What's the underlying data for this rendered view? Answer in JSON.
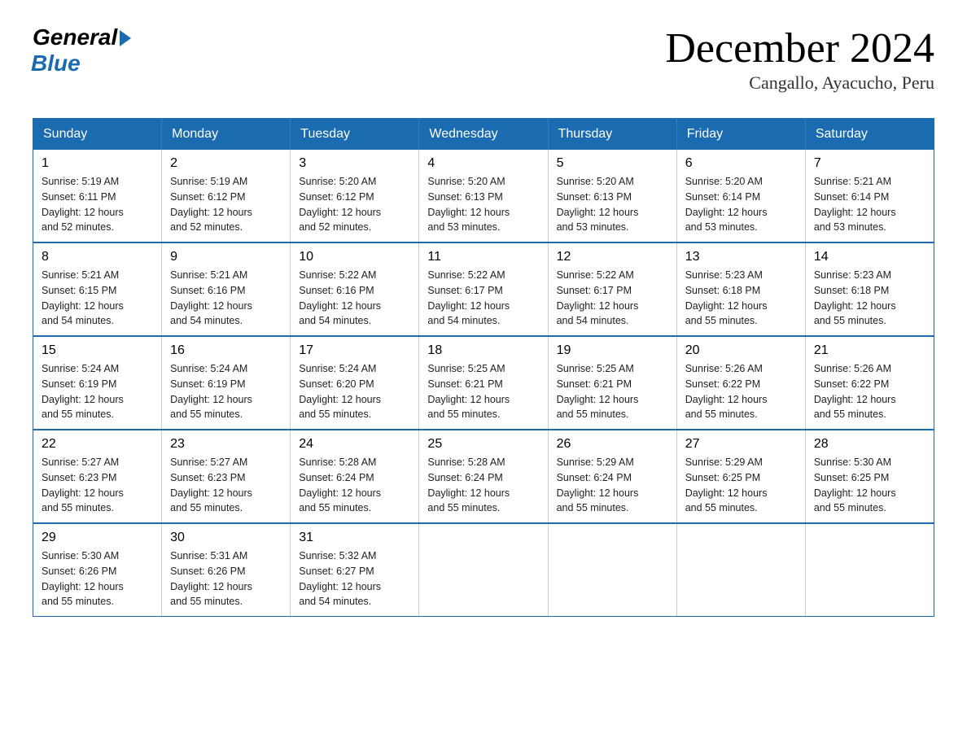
{
  "logo": {
    "general": "General",
    "blue": "Blue"
  },
  "title": "December 2024",
  "subtitle": "Cangallo, Ayacucho, Peru",
  "days_of_week": [
    "Sunday",
    "Monday",
    "Tuesday",
    "Wednesday",
    "Thursday",
    "Friday",
    "Saturday"
  ],
  "weeks": [
    [
      {
        "day": "1",
        "info": "Sunrise: 5:19 AM\nSunset: 6:11 PM\nDaylight: 12 hours\nand 52 minutes."
      },
      {
        "day": "2",
        "info": "Sunrise: 5:19 AM\nSunset: 6:12 PM\nDaylight: 12 hours\nand 52 minutes."
      },
      {
        "day": "3",
        "info": "Sunrise: 5:20 AM\nSunset: 6:12 PM\nDaylight: 12 hours\nand 52 minutes."
      },
      {
        "day": "4",
        "info": "Sunrise: 5:20 AM\nSunset: 6:13 PM\nDaylight: 12 hours\nand 53 minutes."
      },
      {
        "day": "5",
        "info": "Sunrise: 5:20 AM\nSunset: 6:13 PM\nDaylight: 12 hours\nand 53 minutes."
      },
      {
        "day": "6",
        "info": "Sunrise: 5:20 AM\nSunset: 6:14 PM\nDaylight: 12 hours\nand 53 minutes."
      },
      {
        "day": "7",
        "info": "Sunrise: 5:21 AM\nSunset: 6:14 PM\nDaylight: 12 hours\nand 53 minutes."
      }
    ],
    [
      {
        "day": "8",
        "info": "Sunrise: 5:21 AM\nSunset: 6:15 PM\nDaylight: 12 hours\nand 54 minutes."
      },
      {
        "day": "9",
        "info": "Sunrise: 5:21 AM\nSunset: 6:16 PM\nDaylight: 12 hours\nand 54 minutes."
      },
      {
        "day": "10",
        "info": "Sunrise: 5:22 AM\nSunset: 6:16 PM\nDaylight: 12 hours\nand 54 minutes."
      },
      {
        "day": "11",
        "info": "Sunrise: 5:22 AM\nSunset: 6:17 PM\nDaylight: 12 hours\nand 54 minutes."
      },
      {
        "day": "12",
        "info": "Sunrise: 5:22 AM\nSunset: 6:17 PM\nDaylight: 12 hours\nand 54 minutes."
      },
      {
        "day": "13",
        "info": "Sunrise: 5:23 AM\nSunset: 6:18 PM\nDaylight: 12 hours\nand 55 minutes."
      },
      {
        "day": "14",
        "info": "Sunrise: 5:23 AM\nSunset: 6:18 PM\nDaylight: 12 hours\nand 55 minutes."
      }
    ],
    [
      {
        "day": "15",
        "info": "Sunrise: 5:24 AM\nSunset: 6:19 PM\nDaylight: 12 hours\nand 55 minutes."
      },
      {
        "day": "16",
        "info": "Sunrise: 5:24 AM\nSunset: 6:19 PM\nDaylight: 12 hours\nand 55 minutes."
      },
      {
        "day": "17",
        "info": "Sunrise: 5:24 AM\nSunset: 6:20 PM\nDaylight: 12 hours\nand 55 minutes."
      },
      {
        "day": "18",
        "info": "Sunrise: 5:25 AM\nSunset: 6:21 PM\nDaylight: 12 hours\nand 55 minutes."
      },
      {
        "day": "19",
        "info": "Sunrise: 5:25 AM\nSunset: 6:21 PM\nDaylight: 12 hours\nand 55 minutes."
      },
      {
        "day": "20",
        "info": "Sunrise: 5:26 AM\nSunset: 6:22 PM\nDaylight: 12 hours\nand 55 minutes."
      },
      {
        "day": "21",
        "info": "Sunrise: 5:26 AM\nSunset: 6:22 PM\nDaylight: 12 hours\nand 55 minutes."
      }
    ],
    [
      {
        "day": "22",
        "info": "Sunrise: 5:27 AM\nSunset: 6:23 PM\nDaylight: 12 hours\nand 55 minutes."
      },
      {
        "day": "23",
        "info": "Sunrise: 5:27 AM\nSunset: 6:23 PM\nDaylight: 12 hours\nand 55 minutes."
      },
      {
        "day": "24",
        "info": "Sunrise: 5:28 AM\nSunset: 6:24 PM\nDaylight: 12 hours\nand 55 minutes."
      },
      {
        "day": "25",
        "info": "Sunrise: 5:28 AM\nSunset: 6:24 PM\nDaylight: 12 hours\nand 55 minutes."
      },
      {
        "day": "26",
        "info": "Sunrise: 5:29 AM\nSunset: 6:24 PM\nDaylight: 12 hours\nand 55 minutes."
      },
      {
        "day": "27",
        "info": "Sunrise: 5:29 AM\nSunset: 6:25 PM\nDaylight: 12 hours\nand 55 minutes."
      },
      {
        "day": "28",
        "info": "Sunrise: 5:30 AM\nSunset: 6:25 PM\nDaylight: 12 hours\nand 55 minutes."
      }
    ],
    [
      {
        "day": "29",
        "info": "Sunrise: 5:30 AM\nSunset: 6:26 PM\nDaylight: 12 hours\nand 55 minutes."
      },
      {
        "day": "30",
        "info": "Sunrise: 5:31 AM\nSunset: 6:26 PM\nDaylight: 12 hours\nand 55 minutes."
      },
      {
        "day": "31",
        "info": "Sunrise: 5:32 AM\nSunset: 6:27 PM\nDaylight: 12 hours\nand 54 minutes."
      },
      {
        "day": "",
        "info": ""
      },
      {
        "day": "",
        "info": ""
      },
      {
        "day": "",
        "info": ""
      },
      {
        "day": "",
        "info": ""
      }
    ]
  ]
}
